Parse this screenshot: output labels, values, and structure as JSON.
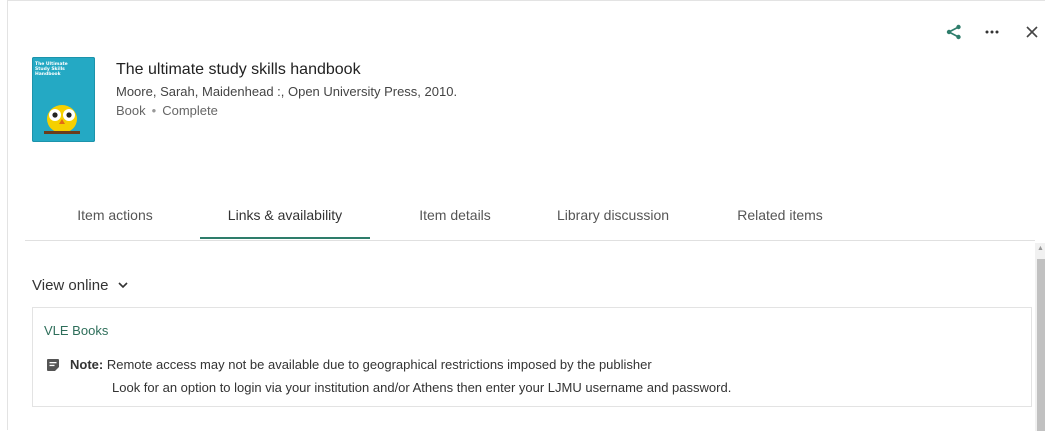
{
  "record": {
    "title": "The ultimate study skills handbook",
    "creator_publication": "Moore, Sarah, Maidenhead :, Open University Press, 2010.",
    "resource_type": "Book",
    "availability_status": "Complete",
    "separator": "•",
    "cover_text": "The Ultimate Study Skills Handbook"
  },
  "tabs": [
    {
      "label": "Item actions"
    },
    {
      "label": "Links & availability"
    },
    {
      "label": "Item details"
    },
    {
      "label": "Library discussion"
    },
    {
      "label": "Related items"
    }
  ],
  "view_online": {
    "heading": "View online",
    "link_label": "VLE Books",
    "note_label": "Note:",
    "note_text": "Remote access may not be available due to geographical restrictions imposed by the publisher",
    "note_text_2": "Look for an option to login via your institution and/or Athens then enter your LJMU username and password."
  },
  "icons": {
    "share": "share-icon",
    "more": "more-options-icon",
    "close": "close-icon",
    "chevron": "chevron-down-icon",
    "note": "note-icon"
  },
  "colors": {
    "accent": "#2e7d6b",
    "link": "#2e6e5a",
    "cover": "#24a9c4"
  }
}
